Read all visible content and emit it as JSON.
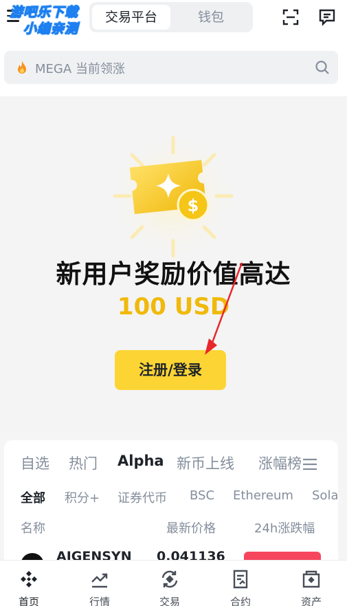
{
  "watermark": {
    "line1": "游吧乐下载",
    "line2": "小编亲测"
  },
  "header": {
    "tabs": [
      {
        "label": "交易平台",
        "active": true
      },
      {
        "label": "钱包",
        "active": false
      }
    ],
    "icons": [
      "menu-icon",
      "scan-icon",
      "message-icon"
    ]
  },
  "search": {
    "placeholder": "MEGA 当前领涨",
    "icon": "flame-icon"
  },
  "banner": {
    "headline": "新用户奖励价值高达",
    "amount": "100 USD",
    "cta_label": "注册/登录",
    "accent_color": "#f0b90b",
    "cta_color": "#fcd535",
    "annotation": "red-arrow-pointing-to-cta"
  },
  "market": {
    "tabs": [
      {
        "label": "自选",
        "active": false
      },
      {
        "label": "热门",
        "active": false
      },
      {
        "label": "Alpha",
        "active": true
      },
      {
        "label": "新币上线",
        "active": false
      },
      {
        "label": "涨幅榜",
        "active": false
      }
    ],
    "subtabs": [
      {
        "label": "全部",
        "active": true
      },
      {
        "label": "积分+",
        "active": false
      },
      {
        "label": "证券代币",
        "active": false
      },
      {
        "label": "BSC",
        "active": false
      },
      {
        "label": "Ethereum",
        "active": false
      },
      {
        "label": "Solana",
        "active": false
      }
    ],
    "columns": {
      "name": "名称",
      "price": "最新价格",
      "change": "24h涨跌幅"
    },
    "rows": [
      {
        "name": "AIGENSYN",
        "price": "0.041136",
        "change_color": "#f6465d"
      }
    ]
  },
  "bottom_nav": [
    {
      "label": "首页",
      "icon": "home-icon",
      "active": true
    },
    {
      "label": "行情",
      "icon": "markets-icon",
      "active": false
    },
    {
      "label": "交易",
      "icon": "trade-icon",
      "active": false
    },
    {
      "label": "合约",
      "icon": "futures-icon",
      "active": false
    },
    {
      "label": "资产",
      "icon": "wallet-icon",
      "active": false
    }
  ]
}
